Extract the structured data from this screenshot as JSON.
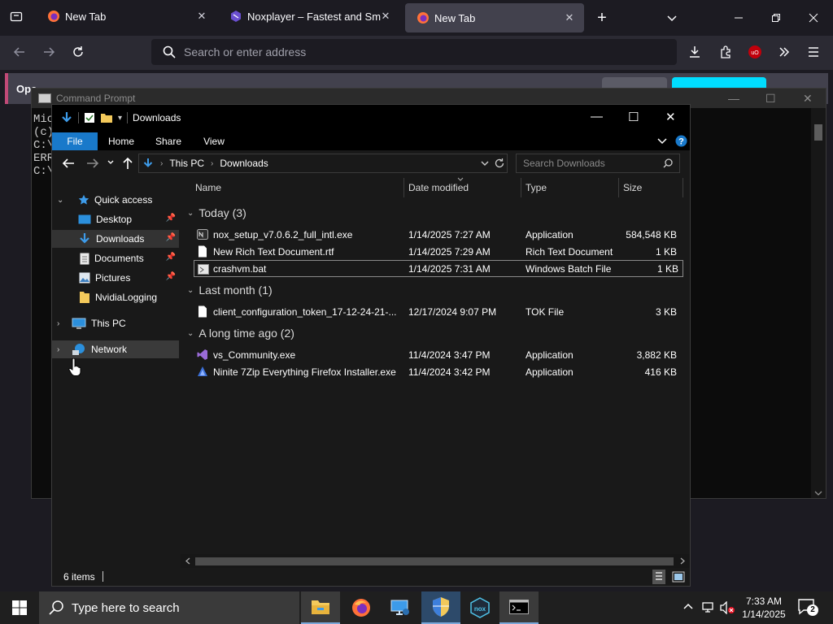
{
  "firefox": {
    "tabs": [
      {
        "title": "New Tab",
        "active": false
      },
      {
        "title": "Noxplayer – Fastest and Smoot",
        "active": false
      },
      {
        "title": "New Tab",
        "active": true
      }
    ],
    "new_tab_symbol": "+",
    "urlbar_placeholder": "Search or enter address",
    "notification_text": "Ope",
    "icons": [
      "tab-list-icon",
      "firefox-icon",
      "nox-icon",
      "back-icon",
      "forward-icon",
      "reload-icon",
      "search-icon",
      "download-icon",
      "extensions-icon",
      "ublock-icon",
      "overflow-icon",
      "hamburger-menu-icon"
    ]
  },
  "cmd": {
    "title": "Command Prompt",
    "lines": [
      "Mic",
      "(c)",
      "",
      "C:\\",
      "ERR",
      "",
      "C:\\"
    ]
  },
  "explorer": {
    "title": "Downloads",
    "ribbon_tabs": [
      "File",
      "Home",
      "Share",
      "View"
    ],
    "breadcrumb": [
      "This PC",
      "Downloads"
    ],
    "search_placeholder": "Search Downloads",
    "nav": {
      "quick_access": "Quick access",
      "items": [
        {
          "label": "Desktop",
          "pinned": true
        },
        {
          "label": "Downloads",
          "pinned": true,
          "selected": true
        },
        {
          "label": "Documents",
          "pinned": true
        },
        {
          "label": "Pictures",
          "pinned": true
        },
        {
          "label": "NvidiaLogging",
          "pinned": false
        }
      ],
      "this_pc": "This PC",
      "network": "Network"
    },
    "columns": {
      "name": "Name",
      "date": "Date modified",
      "type": "Type",
      "size": "Size"
    },
    "groups": [
      {
        "label": "Today (3)",
        "files": [
          {
            "name": "nox_setup_v7.0.6.2_full_intl.exe",
            "date": "1/14/2025 7:27 AM",
            "type": "Application",
            "size": "584,548 KB",
            "icon": "nox-setup-icon"
          },
          {
            "name": "New Rich Text Document.rtf",
            "date": "1/14/2025 7:29 AM",
            "type": "Rich Text Document",
            "size": "1 KB",
            "icon": "rtf-file-icon"
          },
          {
            "name": "crashvm.bat",
            "date": "1/14/2025 7:31 AM",
            "type": "Windows Batch File",
            "size": "1 KB",
            "icon": "batch-file-icon",
            "selected": true
          }
        ]
      },
      {
        "label": "Last month (1)",
        "files": [
          {
            "name": "client_configuration_token_17-12-24-21-...",
            "date": "12/17/2024 9:07 PM",
            "type": "TOK File",
            "size": "3 KB",
            "icon": "generic-file-icon"
          }
        ]
      },
      {
        "label": "A long time ago (2)",
        "files": [
          {
            "name": "vs_Community.exe",
            "date": "11/4/2024 3:47 PM",
            "type": "Application",
            "size": "3,882 KB",
            "icon": "visual-studio-icon"
          },
          {
            "name": "Ninite 7Zip Everything Firefox Installer.exe",
            "date": "11/4/2024 3:42 PM",
            "type": "Application",
            "size": "416 KB",
            "icon": "ninite-icon"
          }
        ]
      }
    ],
    "status": "6 items"
  },
  "taskbar": {
    "search_placeholder": "Type here to search",
    "apps": [
      "file-explorer-icon",
      "firefox-icon",
      "remote-desktop-icon",
      "shield-uac-icon",
      "nox-player-icon",
      "terminal-icon"
    ],
    "time": "7:33 AM",
    "date": "1/14/2025",
    "notification_count": "2"
  }
}
